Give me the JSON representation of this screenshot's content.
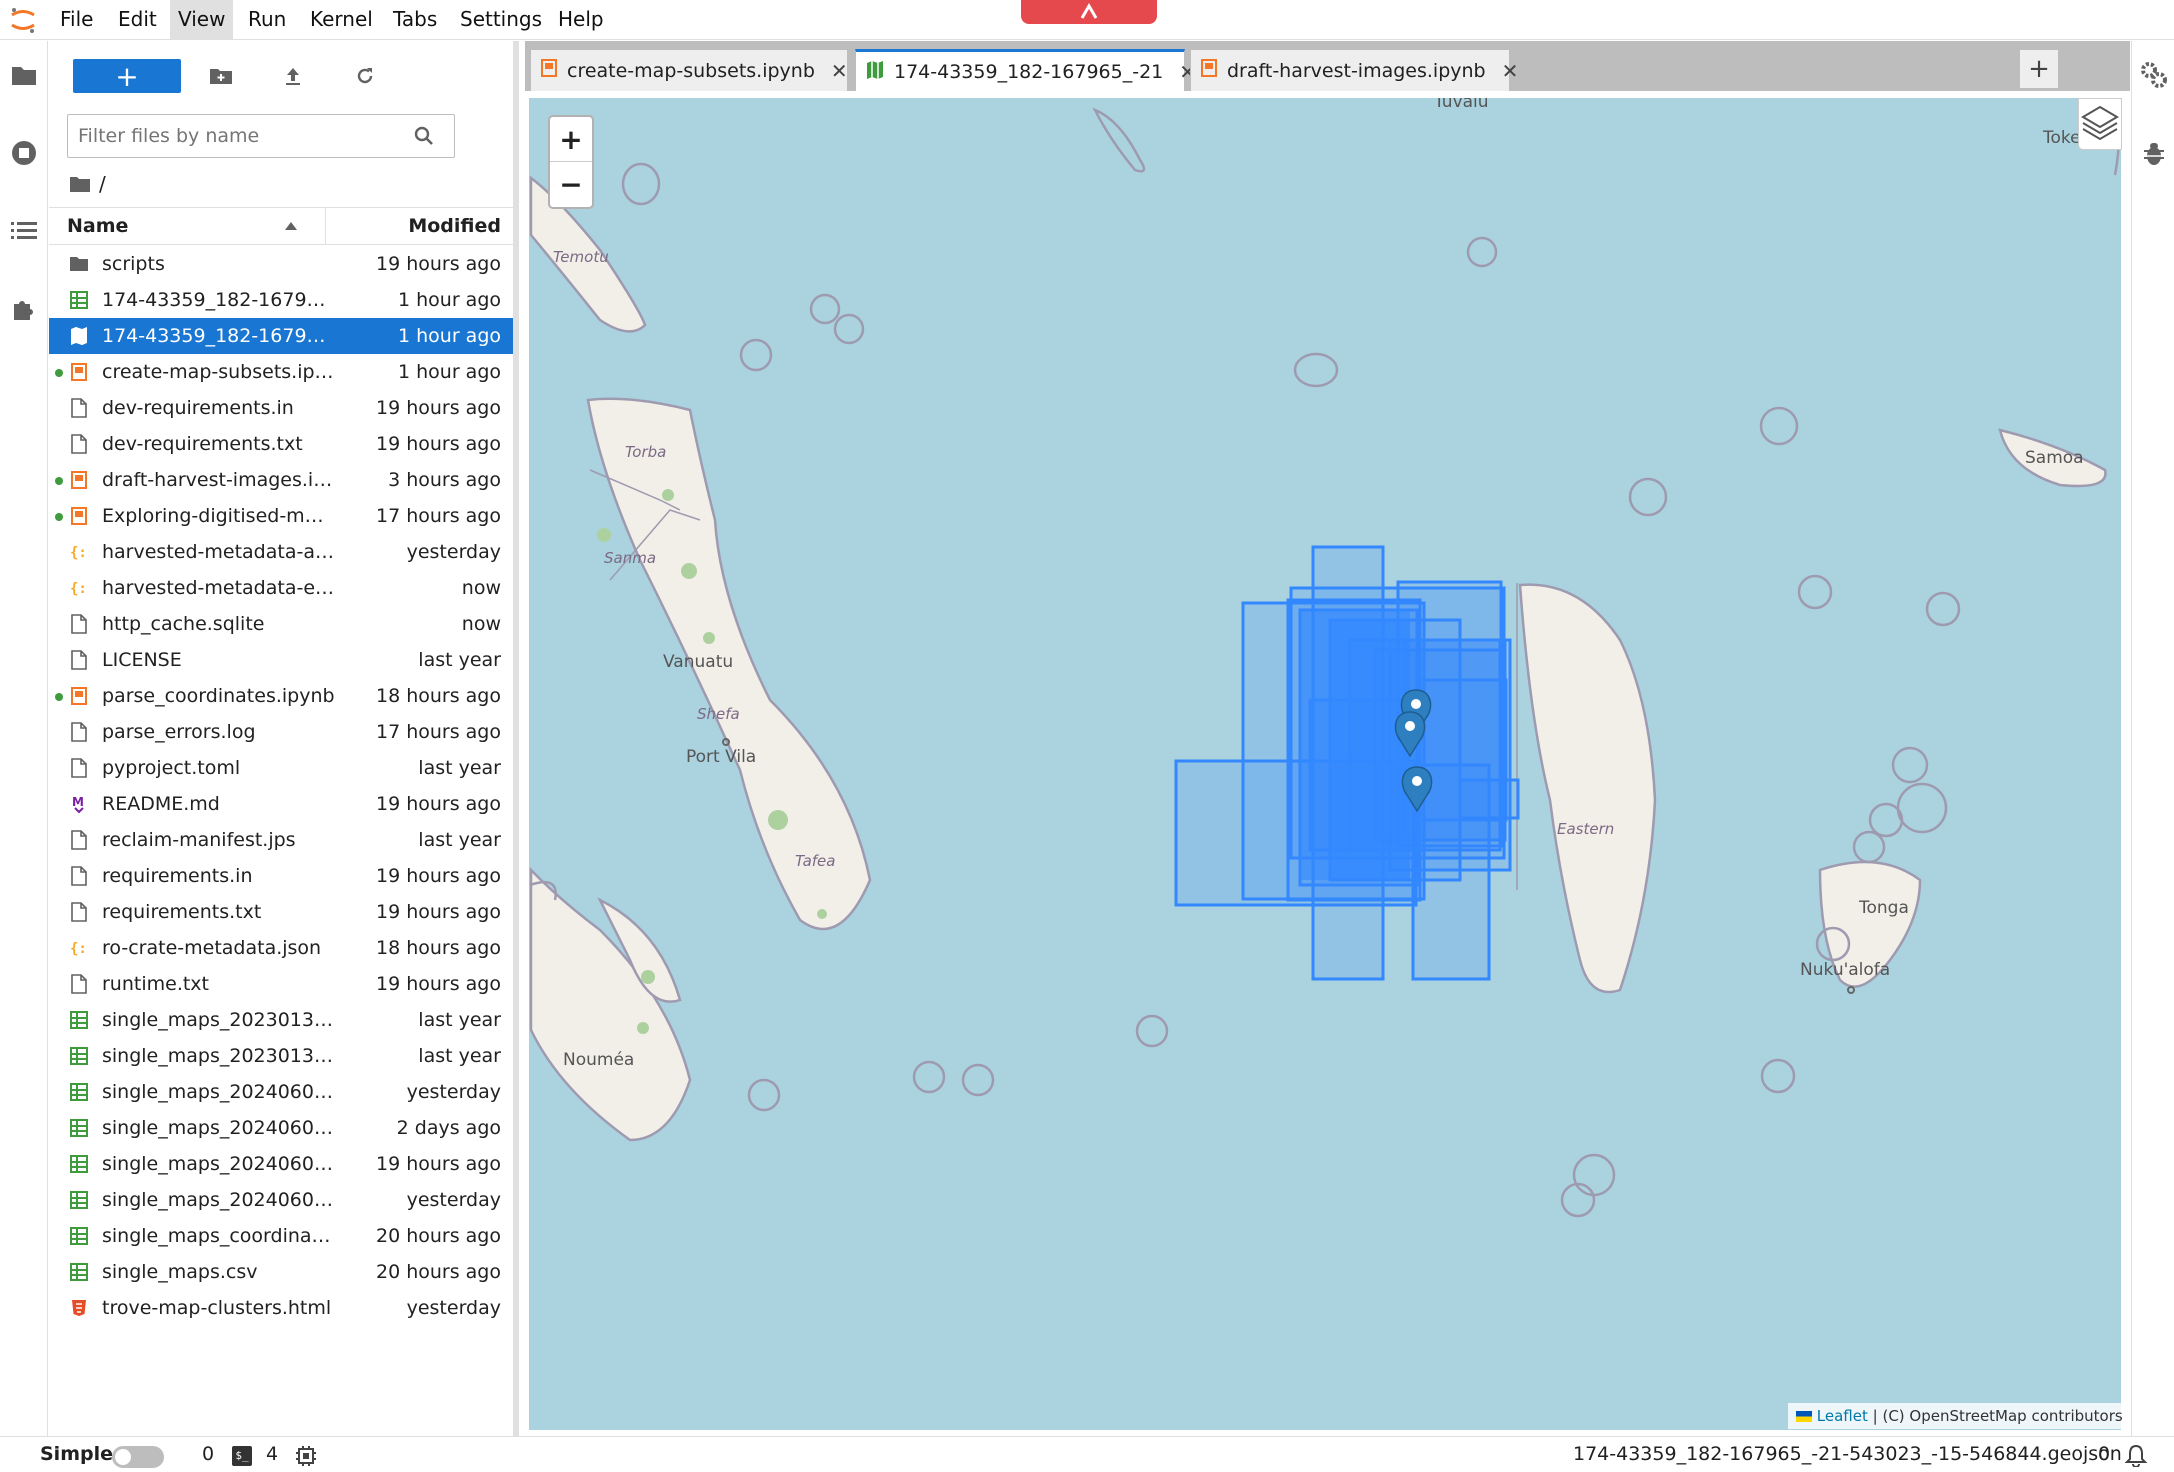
{
  "menubar": {
    "items": [
      "File",
      "Edit",
      "View",
      "Run",
      "Kernel",
      "Tabs",
      "Settings",
      "Help"
    ],
    "active": "View"
  },
  "filebrowser": {
    "filter_placeholder": "Filter files by name",
    "breadcrumb": "/",
    "header_name": "Name",
    "header_modified": "Modified",
    "files": [
      {
        "name": "scripts",
        "modified": "19 hours ago",
        "icon": "folder-icon",
        "running": false,
        "selected": false
      },
      {
        "name": "174-43359_182-1679…",
        "modified": "1 hour ago",
        "icon": "spreadsheet-icon",
        "running": false,
        "selected": false
      },
      {
        "name": "174-43359_182-1679…",
        "modified": "1 hour ago",
        "icon": "geojson-map-icon",
        "running": false,
        "selected": true
      },
      {
        "name": "create-map-subsets.ip…",
        "modified": "1 hour ago",
        "icon": "notebook-icon",
        "running": true,
        "selected": false
      },
      {
        "name": "dev-requirements.in",
        "modified": "19 hours ago",
        "icon": "file-icon",
        "running": false,
        "selected": false
      },
      {
        "name": "dev-requirements.txt",
        "modified": "19 hours ago",
        "icon": "file-icon",
        "running": false,
        "selected": false
      },
      {
        "name": "draft-harvest-images.i…",
        "modified": "3 hours ago",
        "icon": "notebook-icon",
        "running": true,
        "selected": false
      },
      {
        "name": "Exploring-digitised-m…",
        "modified": "17 hours ago",
        "icon": "notebook-icon",
        "running": true,
        "selected": false
      },
      {
        "name": "harvested-metadata-a…",
        "modified": "yesterday",
        "icon": "json-icon",
        "running": false,
        "selected": false
      },
      {
        "name": "harvested-metadata-e…",
        "modified": "now",
        "icon": "json-icon",
        "running": false,
        "selected": false
      },
      {
        "name": "http_cache.sqlite",
        "modified": "now",
        "icon": "file-icon",
        "running": false,
        "selected": false
      },
      {
        "name": "LICENSE",
        "modified": "last year",
        "icon": "file-icon",
        "running": false,
        "selected": false
      },
      {
        "name": "parse_coordinates.ipynb",
        "modified": "18 hours ago",
        "icon": "notebook-icon",
        "running": true,
        "selected": false
      },
      {
        "name": "parse_errors.log",
        "modified": "17 hours ago",
        "icon": "file-icon",
        "running": false,
        "selected": false
      },
      {
        "name": "pyproject.toml",
        "modified": "last year",
        "icon": "file-icon",
        "running": false,
        "selected": false
      },
      {
        "name": "README.md",
        "modified": "19 hours ago",
        "icon": "markdown-icon",
        "running": false,
        "selected": false
      },
      {
        "name": "reclaim-manifest.jps",
        "modified": "last year",
        "icon": "file-icon",
        "running": false,
        "selected": false
      },
      {
        "name": "requirements.in",
        "modified": "19 hours ago",
        "icon": "file-icon",
        "running": false,
        "selected": false
      },
      {
        "name": "requirements.txt",
        "modified": "19 hours ago",
        "icon": "file-icon",
        "running": false,
        "selected": false
      },
      {
        "name": "ro-crate-metadata.json",
        "modified": "18 hours ago",
        "icon": "json-icon",
        "running": false,
        "selected": false
      },
      {
        "name": "runtime.txt",
        "modified": "19 hours ago",
        "icon": "file-icon",
        "running": false,
        "selected": false
      },
      {
        "name": "single_maps_2023013…",
        "modified": "last year",
        "icon": "spreadsheet-icon",
        "running": false,
        "selected": false
      },
      {
        "name": "single_maps_2023013…",
        "modified": "last year",
        "icon": "spreadsheet-icon",
        "running": false,
        "selected": false
      },
      {
        "name": "single_maps_2024060…",
        "modified": "yesterday",
        "icon": "spreadsheet-icon",
        "running": false,
        "selected": false
      },
      {
        "name": "single_maps_2024060…",
        "modified": "2 days ago",
        "icon": "spreadsheet-icon",
        "running": false,
        "selected": false
      },
      {
        "name": "single_maps_2024060…",
        "modified": "19 hours ago",
        "icon": "spreadsheet-icon",
        "running": false,
        "selected": false
      },
      {
        "name": "single_maps_2024060…",
        "modified": "yesterday",
        "icon": "spreadsheet-icon",
        "running": false,
        "selected": false
      },
      {
        "name": "single_maps_coordina…",
        "modified": "20 hours ago",
        "icon": "spreadsheet-icon",
        "running": false,
        "selected": false
      },
      {
        "name": "single_maps.csv",
        "modified": "20 hours ago",
        "icon": "spreadsheet-icon",
        "running": false,
        "selected": false
      },
      {
        "name": "trove-map-clusters.html",
        "modified": "yesterday",
        "icon": "html-icon",
        "running": false,
        "selected": false
      }
    ]
  },
  "tabs": [
    {
      "label": "create-map-subsets.ipynb",
      "icon": "notebook-icon",
      "active": false
    },
    {
      "label": "174-43359_182-167965_-21",
      "icon": "geojson-map-icon",
      "active": true
    },
    {
      "label": "draft-harvest-images.ipynb",
      "icon": "notebook-icon",
      "active": false
    }
  ],
  "map": {
    "zoom_in": "+",
    "zoom_out": "−",
    "labels": {
      "tuvalu": "Tuvalu",
      "tokelau": "Toke",
      "temotu": "Temotu",
      "torba": "Torba",
      "sanma": "Sanma",
      "vanuatu": "Vanuatu",
      "shefa": "Shefa",
      "port_vila": "Port Vila",
      "tafea": "Tafea",
      "noumea": "Nouméa",
      "samoa": "Samoa",
      "eastern": "Eastern",
      "tonga": "Tonga",
      "nukualofa": "Nuku'alofa"
    },
    "attribution_link": "Leaflet",
    "attribution_text": "| (C) OpenStreetMap contributors",
    "colors": {
      "water": "#aad3df",
      "land": "#f2efe9",
      "feature": "#3388ff",
      "boundary": "#9e9ab0"
    }
  },
  "statusbar": {
    "mode": "Simple",
    "kernels": "0",
    "terminals": "4",
    "filename": "174-43359_182-167965_-21-543023_-15-546844.geojson",
    "notifications": "0"
  }
}
